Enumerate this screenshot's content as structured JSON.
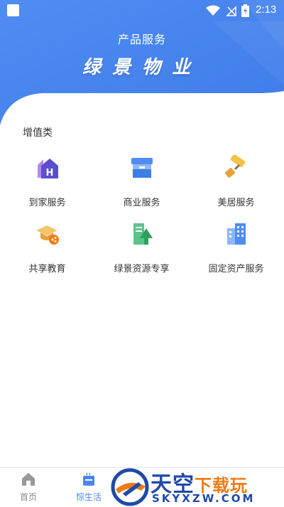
{
  "status_bar": {
    "time": "2:13"
  },
  "header": {
    "page_title": "产品服务",
    "brand_title": "绿景物业"
  },
  "section": {
    "title": "增值类",
    "items": [
      {
        "label": "到家服务",
        "icon": "home-service-icon"
      },
      {
        "label": "商业服务",
        "icon": "store-icon"
      },
      {
        "label": "美居服务",
        "icon": "paint-roller-icon"
      },
      {
        "label": "共享教育",
        "icon": "graduation-cap-icon"
      },
      {
        "label": "绿景资源专享",
        "icon": "building-tree-icon"
      },
      {
        "label": "固定资产服务",
        "icon": "office-building-icon"
      }
    ]
  },
  "bottom_nav": {
    "items": [
      {
        "label": "首页",
        "icon": "home-icon",
        "active": false
      },
      {
        "label": "悰生活",
        "icon": "cup-icon",
        "active": true
      }
    ]
  },
  "watermark": {
    "cn_main": "天空",
    "cn_accent": "下载玩",
    "en": "SKYXZW.COM"
  },
  "colors": {
    "header_blue": "#4a86ef",
    "active_nav": "#4a86ef"
  }
}
